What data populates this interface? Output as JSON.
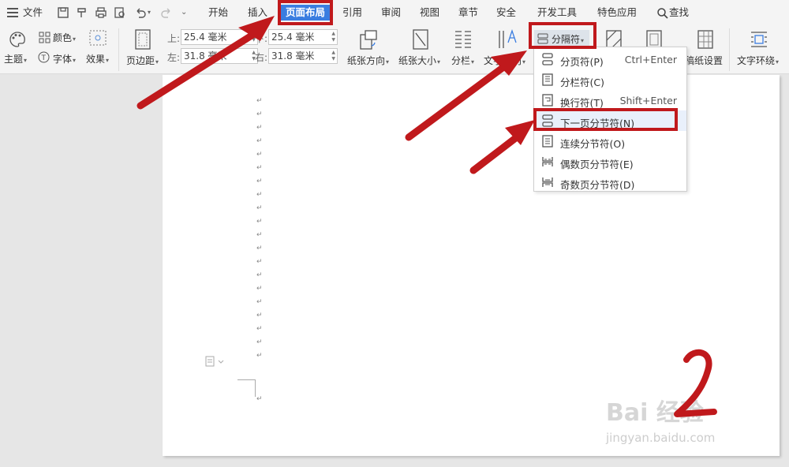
{
  "menubar": {
    "file": "文件",
    "tabs": [
      {
        "label": "开始",
        "active": false
      },
      {
        "label": "插入",
        "active": false
      },
      {
        "label": "页面布局",
        "active": true
      },
      {
        "label": "引用",
        "active": false
      },
      {
        "label": "审阅",
        "active": false
      },
      {
        "label": "视图",
        "active": false
      },
      {
        "label": "章节",
        "active": false
      },
      {
        "label": "安全",
        "active": false
      },
      {
        "label": "开发工具",
        "active": false
      },
      {
        "label": "特色应用",
        "active": false
      }
    ],
    "search": "查找"
  },
  "ribbon": {
    "color": "颜色",
    "theme": "主题",
    "font": "字体",
    "effect": "效果",
    "margin": "页边距",
    "top_label": "上:",
    "top_value": "25.4 毫米",
    "bottom_value": "25.4 毫米",
    "left_label": "左:",
    "left_value": "31.8 毫米",
    "right_label": "右:",
    "right_value": "31.8 毫米",
    "orientation": "纸张方向",
    "size": "纸张大小",
    "columns": "分栏",
    "text_direction": "文字方向",
    "breaks": "分隔符",
    "draft_settings": "稿纸设置",
    "text_wrap": "文字环绕"
  },
  "dropdown": {
    "items": [
      {
        "label": "分页符(P)",
        "shortcut": "Ctrl+Enter"
      },
      {
        "label": "分栏符(C)",
        "shortcut": ""
      },
      {
        "label": "换行符(T)",
        "shortcut": "Shift+Enter"
      },
      {
        "label": "下一页分节符(N)",
        "shortcut": ""
      },
      {
        "label": "连续分节符(O)",
        "shortcut": ""
      },
      {
        "label": "偶数页分节符(E)",
        "shortcut": ""
      },
      {
        "label": "奇数页分节符(D)",
        "shortcut": ""
      }
    ]
  },
  "document": {
    "paragraph_mark": "↵"
  },
  "annotation": {
    "step_number": "2",
    "arrow_color": "#c0191c"
  },
  "watermark": {
    "brand": "Bai 经验",
    "url": "jingyan.baidu.com"
  },
  "colors": {
    "accent_blue": "#3a7de0",
    "highlight_red": "#c0191c"
  }
}
